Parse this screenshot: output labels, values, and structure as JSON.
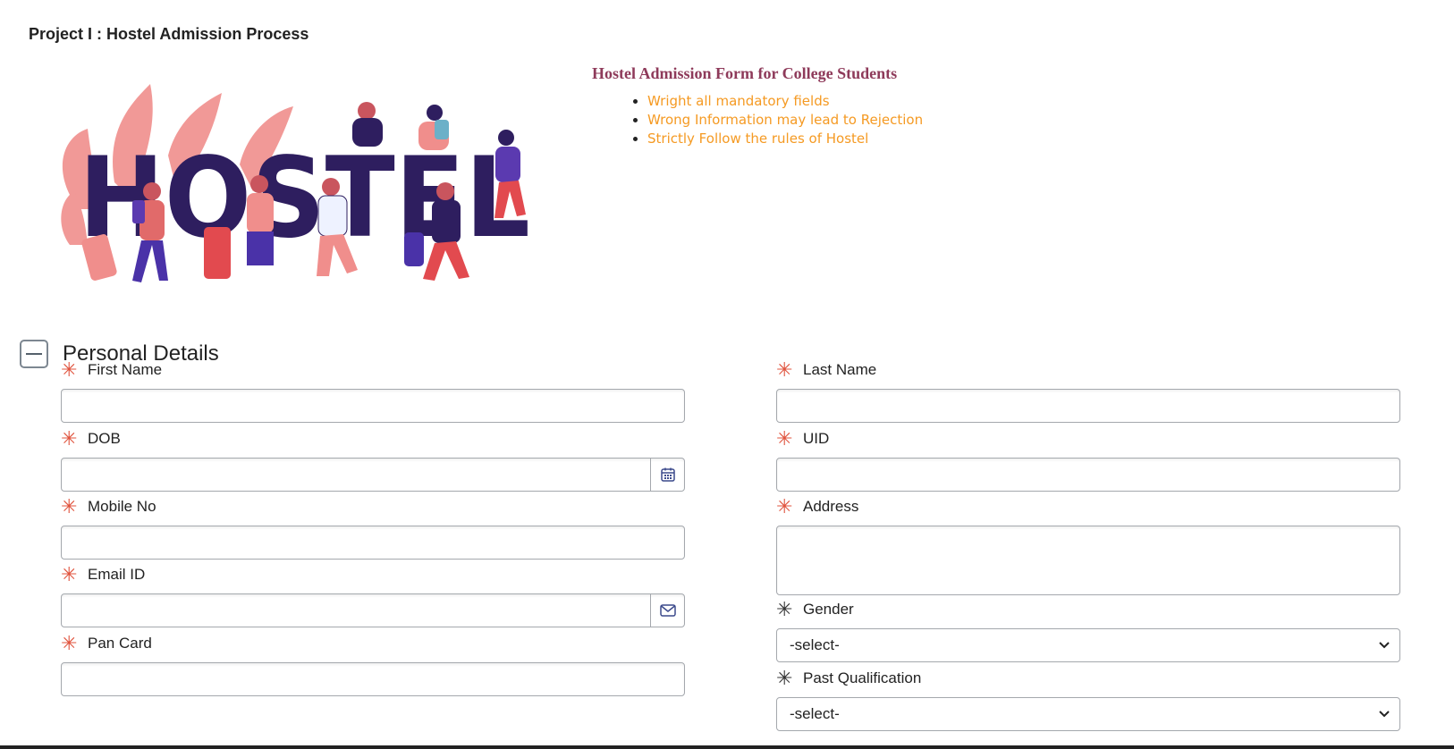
{
  "page_title": "Project I : Hostel Admission Process",
  "hero": {
    "word": "HOSTEL"
  },
  "info": {
    "title": "Hostel Admission Form for College Students",
    "rules": [
      "Wright all mandatory fields",
      "Wrong Information may lead to Rejection",
      "Strictly Follow the rules of Hostel"
    ]
  },
  "section": {
    "title": "Personal Details"
  },
  "fields": {
    "first_name": {
      "label": "First Name",
      "value": ""
    },
    "last_name": {
      "label": "Last Name",
      "value": ""
    },
    "dob": {
      "label": "DOB",
      "value": ""
    },
    "uid": {
      "label": "UID",
      "value": ""
    },
    "mobile": {
      "label": "Mobile No",
      "value": ""
    },
    "address": {
      "label": "Address",
      "value": ""
    },
    "email": {
      "label": "Email ID",
      "value": ""
    },
    "gender": {
      "label": "Gender",
      "selected": "-select-"
    },
    "pan": {
      "label": "Pan Card",
      "value": ""
    },
    "qualification": {
      "label": "Past Qualification",
      "selected": "-select-"
    }
  },
  "icons": {
    "required": "asterisk-icon",
    "calendar": "calendar-icon",
    "email": "envelope-icon",
    "collapse": "minus-icon",
    "dropdown": "chevron-down-icon"
  },
  "colors": {
    "required_red": "#e0533d",
    "title_maroon": "#8e3a5a",
    "rule_orange": "#f59a23",
    "hostel_purple": "#2e1e5f",
    "coral": "#e8767a"
  }
}
